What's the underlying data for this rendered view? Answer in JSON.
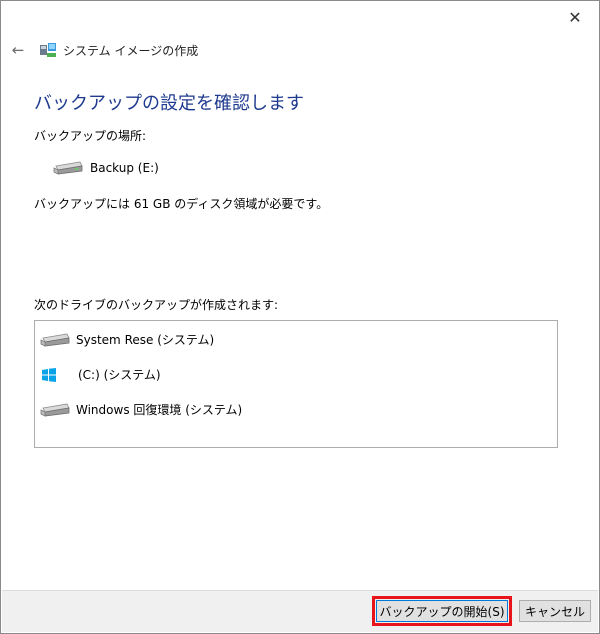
{
  "window": {
    "title": "システム イメージの作成",
    "close_label": "✕",
    "back_label": "←"
  },
  "main": {
    "heading": "バックアップの設定を確認します",
    "location_label": "バックアップの場所:",
    "location_drive": "Backup (E:)",
    "space_required": "バックアップには 61 GB のディスク領域が必要です。",
    "drives_label": "次のドライブのバックアップが作成されます:",
    "drives": [
      {
        "label": "System Rese (システム)",
        "icon": "hard-drive-icon"
      },
      {
        "label": "(C:) (システム)",
        "icon": "windows-logo-icon"
      },
      {
        "label": "Windows 回復環境 (システム)",
        "icon": "hard-drive-icon"
      }
    ]
  },
  "footer": {
    "start_button": "バックアップの開始(S)",
    "cancel_button": "キャンセル"
  },
  "colors": {
    "heading": "#1e3a8f",
    "highlight": "#e8141c",
    "footer_bg": "#f0f0f0"
  }
}
